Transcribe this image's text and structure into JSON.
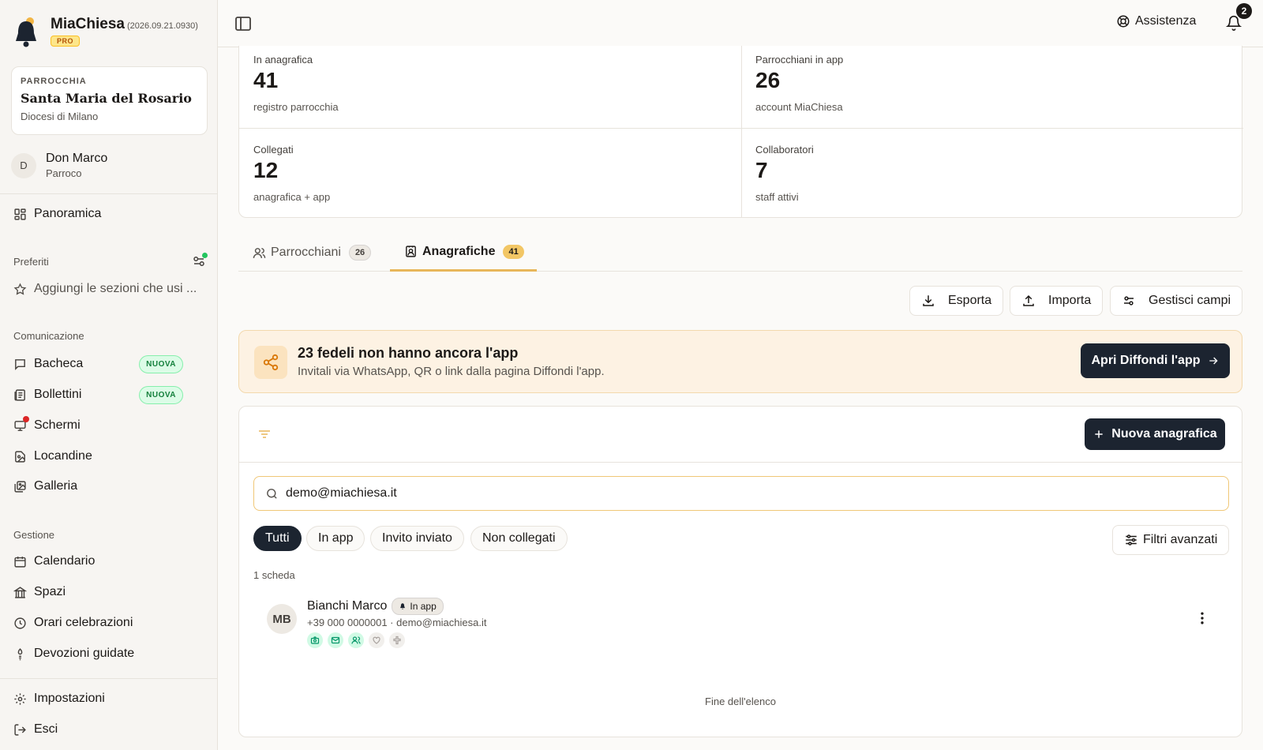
{
  "brand": {
    "name": "MiaChiesa",
    "version": "(2026.09.21.0930)",
    "plan": "PRO"
  },
  "parish": {
    "kicker": "PARROCCHIA",
    "name": "Santa Maria del Rosario",
    "diocese": "Diocesi di Milano"
  },
  "user": {
    "initial": "D",
    "name": "Don Marco",
    "role": "Parroco"
  },
  "nav": {
    "overview": "Panoramica",
    "favorites_label": "Preferiti",
    "favorites_add": "Aggiungi le sezioni che usi ...",
    "communication_label": "Comunicazione",
    "communication": [
      {
        "label": "Bacheca",
        "badge": "NUOVA",
        "icon": "message-square-icon"
      },
      {
        "label": "Bollettini",
        "badge": "NUOVA",
        "icon": "newspaper-icon"
      },
      {
        "label": "Schermi",
        "icon": "monitor-icon",
        "alert": true
      },
      {
        "label": "Locandine",
        "icon": "file-image-icon"
      },
      {
        "label": "Galleria",
        "icon": "images-icon"
      }
    ],
    "management_label": "Gestione",
    "management": [
      {
        "label": "Calendario",
        "icon": "calendar-icon"
      },
      {
        "label": "Spazi",
        "icon": "landmark-icon"
      },
      {
        "label": "Orari celebrazioni",
        "icon": "clock-icon"
      },
      {
        "label": "Devozioni guidate",
        "icon": "candle-icon"
      }
    ],
    "settings": "Impostazioni",
    "logout": "Esci"
  },
  "topbar": {
    "help": "Assistenza",
    "notifications": "2"
  },
  "stats": [
    {
      "label": "In anagrafica",
      "value": "41",
      "sub": "registro parrocchia"
    },
    {
      "label": "Parrocchiani in app",
      "value": "26",
      "sub": "account MiaChiesa"
    },
    {
      "label": "Collegati",
      "value": "12",
      "sub": "anagrafica + app"
    },
    {
      "label": "Collaboratori",
      "value": "7",
      "sub": "staff attivi"
    }
  ],
  "tabs": [
    {
      "label": "Parrocchiani",
      "count": "26",
      "active": false
    },
    {
      "label": "Anagrafiche",
      "count": "41",
      "active": true
    }
  ],
  "actions": {
    "export": "Esporta",
    "import": "Importa",
    "fields": "Gestisci campi"
  },
  "banner": {
    "title": "23 fedeli non hanno ancora l'app",
    "subtitle": "Invitali via WhatsApp, QR o link dalla pagina Diffondi l'app.",
    "button": "Apri Diffondi l'app"
  },
  "list": {
    "new_button": "Nuova anagrafica",
    "search_value": "demo@miachiesa.it",
    "filters": [
      "Tutti",
      "In app",
      "Invito inviato",
      "Non collegati"
    ],
    "active_filter": "Tutti",
    "advanced_filters": "Filtri avanzati",
    "count": "1 scheda",
    "rows": [
      {
        "initials": "MB",
        "name": "Bianchi Marco",
        "badge": "In app",
        "contact": "+39 000 0000001 · demo@miachiesa.it",
        "badges": [
          "camera-icon",
          "mail-icon",
          "users-icon",
          "heart-handshake-icon",
          "cross-icon"
        ]
      }
    ],
    "end": "Fine dell'elenco"
  },
  "colors": {
    "accent": "#e8b65a",
    "dark": "#1c2430",
    "green": "#22c55e",
    "red": "#dc2626",
    "banner": "#fdf2e3"
  }
}
